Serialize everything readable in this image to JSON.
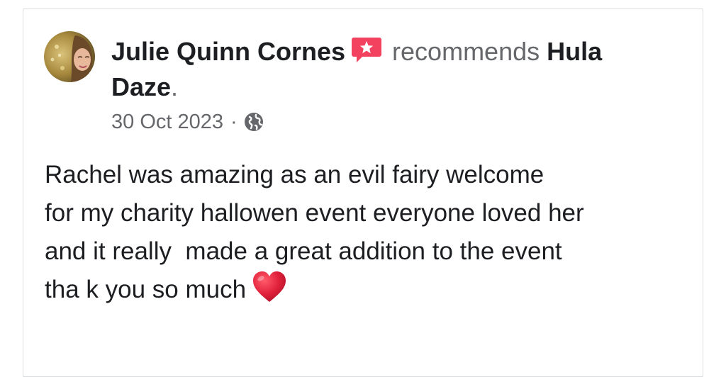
{
  "post": {
    "author": "Julie Quinn Cornes",
    "action": "recommends",
    "page_name_line1": "Hula",
    "page_name_line2": "Daze",
    "end_punct": ".",
    "date": "30 Oct 2023",
    "separator": "·",
    "privacy_icon": "globe-icon",
    "recommend_icon": "recommend-star-bubble-icon",
    "body_lines": [
      "Rachel was amazing as an evil fairy welcome",
      "for my charity hallowen event everyone loved her",
      "and it really  made a great addition to the event",
      "tha k you so much"
    ],
    "emoji": "red-heart-icon"
  },
  "colors": {
    "recommend_icon": "#f3425f",
    "heart": "#e0203a",
    "secondary_text": "#65676b",
    "primary_text": "#1c1e21",
    "card_border": "#dcdde1"
  }
}
